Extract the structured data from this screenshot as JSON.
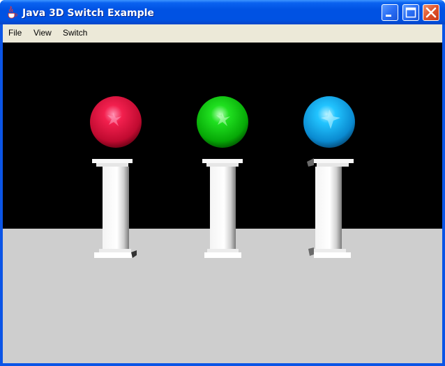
{
  "window": {
    "title": "Java 3D Switch Example",
    "icon": "java-cup-icon"
  },
  "title_buttons": {
    "minimize": "minimize-icon",
    "maximize": "maximize-icon",
    "close": "close-icon"
  },
  "menubar": {
    "items": [
      {
        "label": "File"
      },
      {
        "label": "View"
      },
      {
        "label": "Switch"
      }
    ]
  },
  "scene": {
    "background": "#000000",
    "floor_color": "#cecece",
    "spheres": [
      {
        "name": "red-sphere",
        "color": "#e8103c"
      },
      {
        "name": "green-sphere",
        "color": "#12d812"
      },
      {
        "name": "blue-sphere",
        "color": "#10b4f0"
      }
    ],
    "pillars": 3
  }
}
